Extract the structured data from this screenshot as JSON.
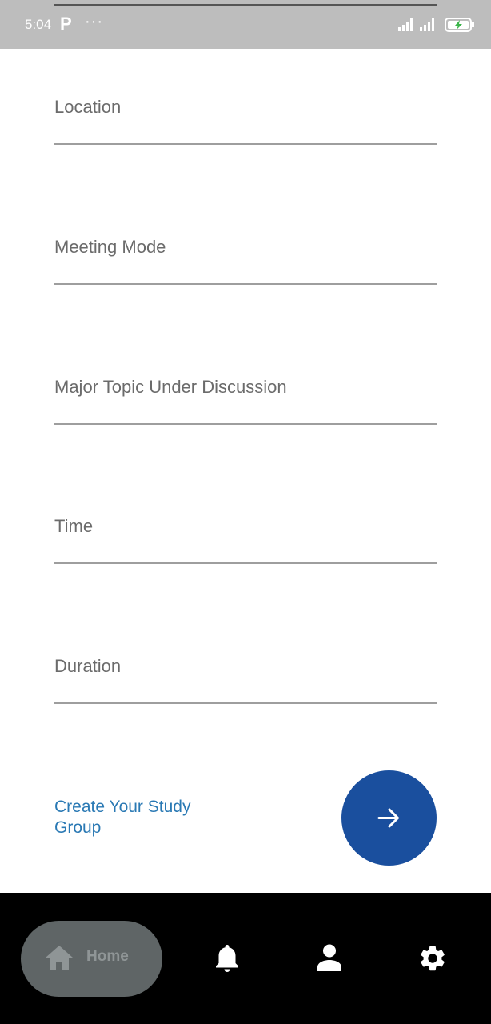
{
  "status_bar": {
    "time": "5:04",
    "p_icon": "P",
    "more": "···"
  },
  "form": {
    "fields": [
      {
        "label": "Location"
      },
      {
        "label": "Meeting Mode"
      },
      {
        "label": "Major Topic Under Discussion"
      },
      {
        "label": "Time"
      },
      {
        "label": "Duration"
      }
    ]
  },
  "footer": {
    "create_link": "Create Your Study Group",
    "next_icon": "arrow-right-icon"
  },
  "bottom_nav": {
    "home_label": "Home",
    "icons": [
      "home-icon",
      "bell-icon",
      "person-icon",
      "gear-icon"
    ]
  },
  "colors": {
    "status_bar": "#bdbdbd",
    "link": "#2a79b4",
    "fab": "#1a4f9e",
    "nav_bg": "#000000",
    "home_pill": "#5f6566"
  }
}
